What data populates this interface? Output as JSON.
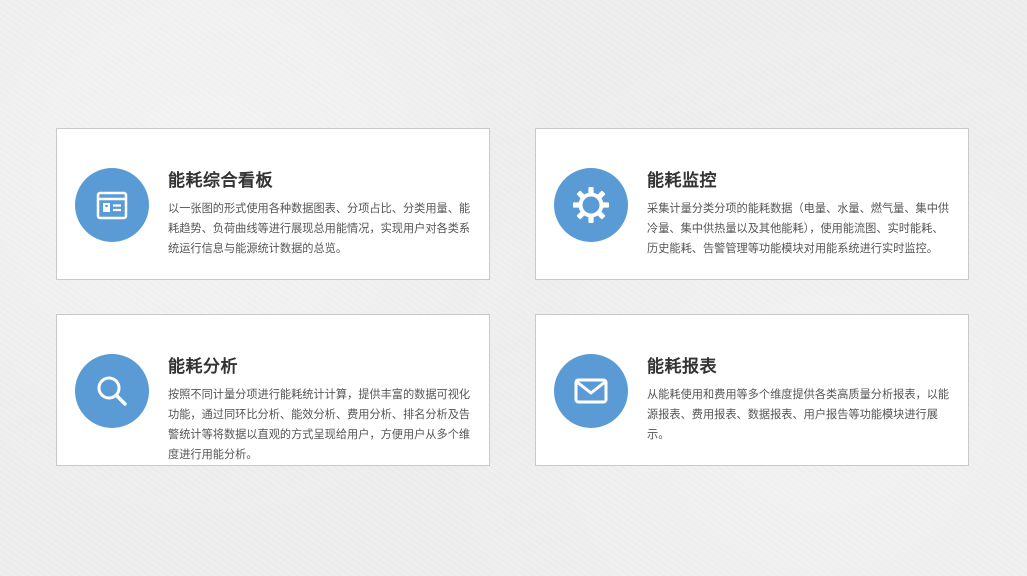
{
  "accent_color": "#5b9bd5",
  "cards": [
    {
      "icon": "dashboard-icon",
      "title": "能耗综合看板",
      "description": "以一张图的形式使用各种数据图表、分项占比、分类用量、能耗趋势、负荷曲线等进行展现总用能情况，实现用户对各类系统运行信息与能源统计数据的总览。"
    },
    {
      "icon": "gear-icon",
      "title": "能耗监控",
      "description": "采集计量分类分项的能耗数据（电量、水量、燃气量、集中供冷量、集中供热量以及其他能耗），使用能流图、实时能耗、历史能耗、告警管理等功能模块对用能系统进行实时监控。"
    },
    {
      "icon": "search-icon",
      "title": "能耗分析",
      "description": "按照不同计量分项进行能耗统计计算，提供丰富的数据可视化功能，通过同环比分析、能效分析、费用分析、排名分析及告警统计等将数据以直观的方式呈现给用户，方便用户从多个维度进行用能分析。"
    },
    {
      "icon": "envelope-icon",
      "title": "能耗报表",
      "description": "从能耗使用和费用等多个维度提供各类高质量分析报表，以能源报表、费用报表、数据报表、用户报告等功能模块进行展示。"
    }
  ]
}
